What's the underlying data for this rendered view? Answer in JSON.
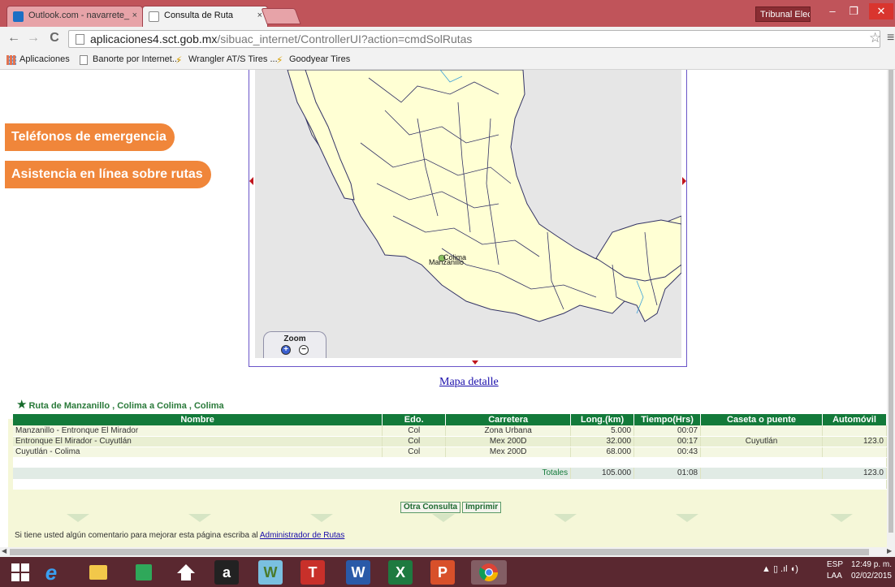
{
  "browser": {
    "tabs": [
      {
        "label": "Outlook.com - navarrete_",
        "active": false,
        "close": "×"
      },
      {
        "label": "Consulta de Ruta",
        "active": true,
        "close": "×"
      }
    ],
    "window_label": "Tribunal Elect...",
    "window_controls": {
      "minimize": "–",
      "restore": "❐",
      "close": "✕"
    },
    "nav": {
      "back": "←",
      "forward": "→",
      "reload": "C"
    },
    "url_host": "aplicaciones4.sct.gob.mx",
    "url_path": "/sibuac_internet/ControllerUI?action=cmdSolRutas",
    "star": "☆",
    "menu": "≡",
    "bookmarks": [
      {
        "label": "Aplicaciones",
        "icon": "apps-grid-icon"
      },
      {
        "label": "Banorte por Internet...",
        "icon": "page-icon"
      },
      {
        "label": "Wrangler AT/S Tires ...",
        "icon": "goodyear-icon"
      },
      {
        "label": "Goodyear Tires",
        "icon": "goodyear-icon"
      }
    ]
  },
  "sidebar": {
    "emergency_label": "Teléfonos de emergencia",
    "assist_label": "Asistencia en línea sobre rutas"
  },
  "map": {
    "labels": {
      "manzanillo": "Manzanillo",
      "colima": "Colima"
    },
    "zoom_label": "Zoom",
    "zoom_in": "+",
    "zoom_out": "−",
    "detail_link": "Mapa detalle",
    "colors": {
      "land": "#ffffd4",
      "water": "#e6e6e6",
      "border": "#333366",
      "frame": "#6a55c8"
    }
  },
  "route": {
    "title": "Ruta de Manzanillo , Colima  a Colima , Colima",
    "headers": [
      "Nombre",
      "Edo.",
      "Carretera",
      "Long.(km)",
      "Tiempo(Hrs)",
      "Caseta o puente",
      "Automóvil"
    ],
    "rows": [
      [
        "Manzanillo - Entronque El Mirador",
        "Col",
        "Zona Urbana",
        "5.000",
        "00:07",
        "",
        ""
      ],
      [
        "Entronque El Mirador - Cuyutlán",
        "Col",
        "Mex 200D",
        "32.000",
        "00:17",
        "Cuyutlán",
        "123.0"
      ],
      [
        "Cuyutlán - Colima",
        "Col",
        "Mex 200D",
        "68.000",
        "00:43",
        "",
        ""
      ]
    ],
    "totals": {
      "label": "Totales",
      "length": "105.000",
      "time": "01:08",
      "auto": "123.0"
    },
    "header_color": "#137a3a"
  },
  "actions": {
    "other_query": "Otra Consulta",
    "print": "Imprimir"
  },
  "footer": {
    "comment_prefix": "Si tiene usted algún comentario para mejorar esta página escriba al ",
    "comment_link": "Administrador de Rutas"
  },
  "taskbar": {
    "icons": [
      "windows-start-icon",
      "internet-explorer-icon",
      "file-explorer-icon",
      "store-icon",
      "home-icon",
      "amazon-icon",
      "w-app-icon",
      "t-app-icon",
      "word-icon",
      "excel-icon",
      "powerpoint-icon",
      "chrome-icon"
    ],
    "glyphs": {
      "amazon": "a",
      "w_app": "W",
      "t_app": "T",
      "word": "W",
      "excel": "X",
      "powerpoint": "P"
    },
    "tray_symbols": "▲  ▯ .ıl ◖)",
    "lang_top": "ESP",
    "lang_bottom": "LAA",
    "time": "12:49 p. m.",
    "date": "02/02/2015"
  }
}
